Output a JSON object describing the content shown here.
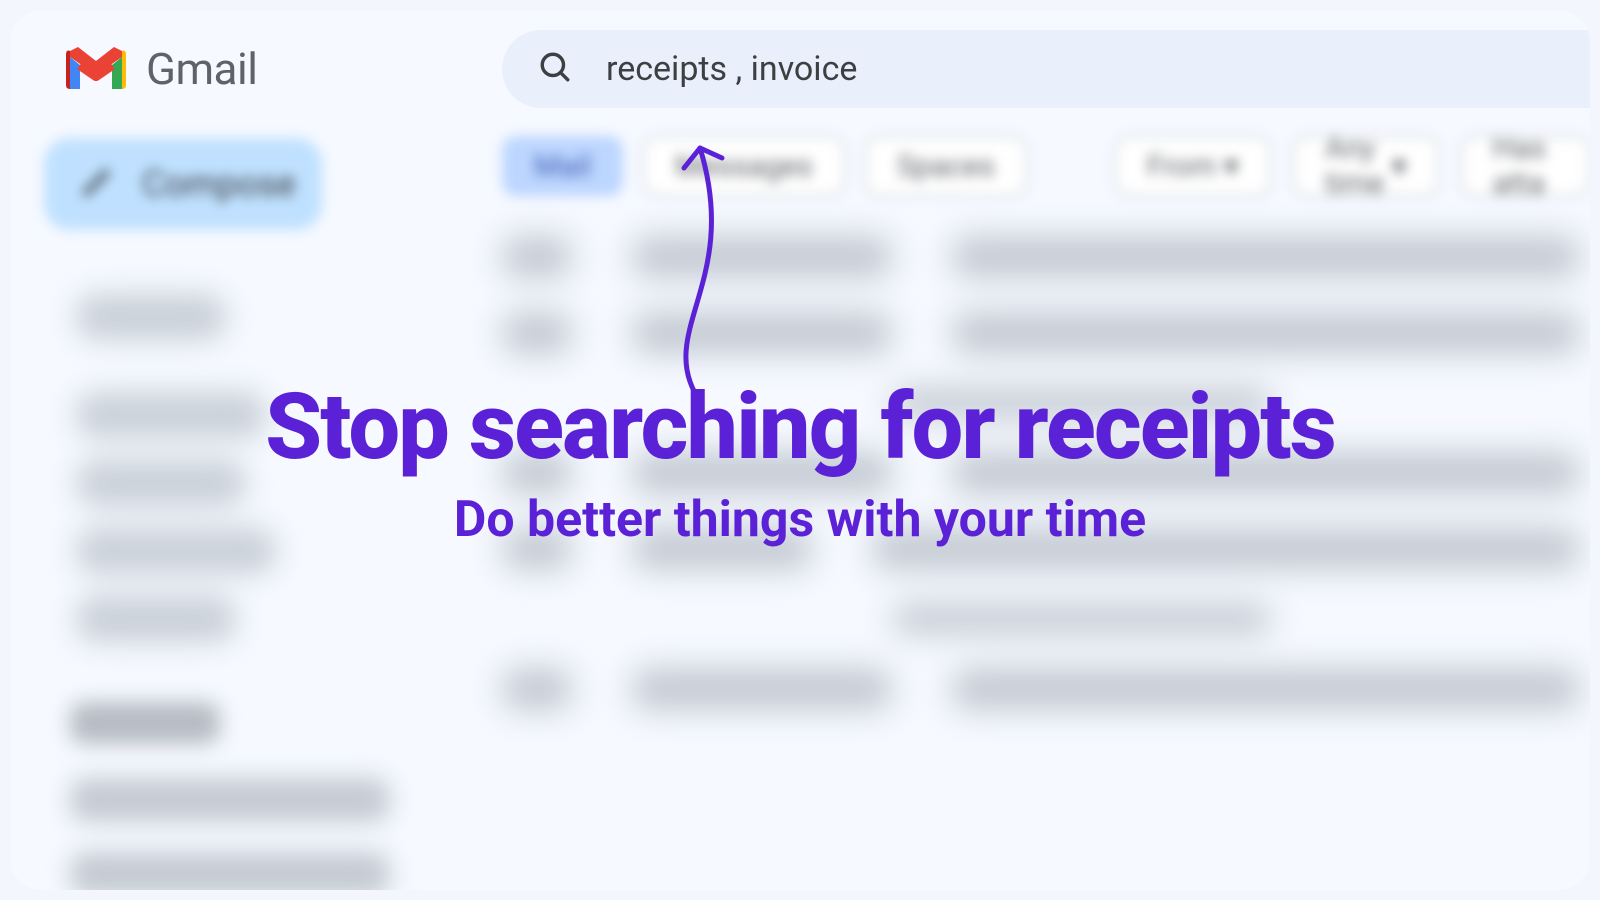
{
  "brand": {
    "name": "Gmail"
  },
  "search": {
    "query": "receipts , invoice"
  },
  "compose": {
    "label": "Compose"
  },
  "tabs": {
    "mail": "Mail",
    "messages": "Messages",
    "spaces": "Spaces"
  },
  "filters": {
    "from": "From",
    "anytime": "Any time",
    "hasatt": "Has atta"
  },
  "labels_header": "Labels",
  "overlay": {
    "headline": "Stop searching for receipts",
    "subline": "Do better things with your time"
  },
  "colors": {
    "accent": "#5b21d6",
    "search_bg": "#e9f0fb",
    "compose_bg": "#bfe1ff"
  }
}
